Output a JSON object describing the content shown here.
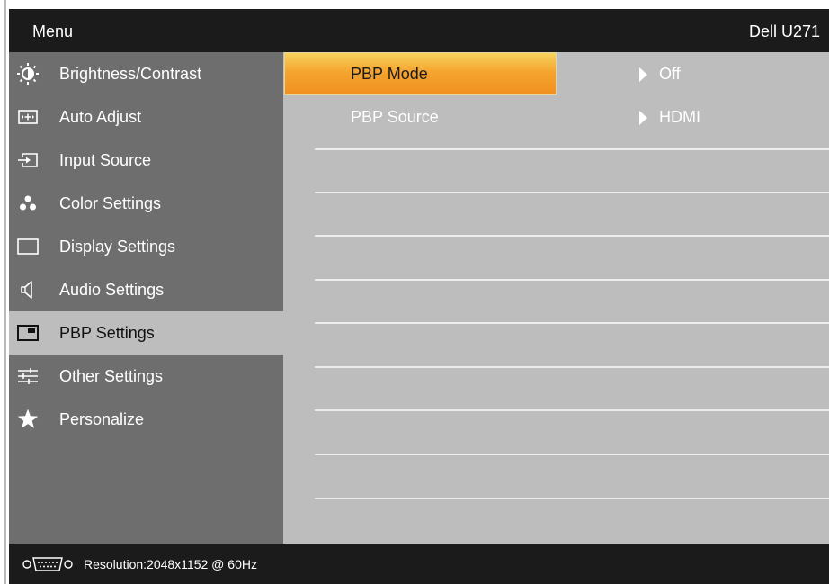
{
  "header": {
    "menu_title": "Menu",
    "model": "Dell U271"
  },
  "sidebar": {
    "items": [
      {
        "label": "Brightness/Contrast",
        "icon": "brightness-icon"
      },
      {
        "label": "Auto Adjust",
        "icon": "auto-adjust-icon"
      },
      {
        "label": "Input Source",
        "icon": "input-source-icon"
      },
      {
        "label": "Color Settings",
        "icon": "color-settings-icon"
      },
      {
        "label": "Display Settings",
        "icon": "display-settings-icon"
      },
      {
        "label": "Audio Settings",
        "icon": "speaker-icon"
      },
      {
        "label": "PBP Settings",
        "icon": "pbp-icon",
        "active": true
      },
      {
        "label": "Other Settings",
        "icon": "sliders-icon"
      },
      {
        "label": "Personalize",
        "icon": "star-icon"
      }
    ]
  },
  "options": [
    {
      "label": "PBP Mode",
      "value": "Off",
      "selected": true
    },
    {
      "label": "PBP Source",
      "value": "HDMI"
    }
  ],
  "status": {
    "resolution": "Resolution:2048x1152 @ 60Hz",
    "icon": "vga-port-icon"
  },
  "colors": {
    "titlebar": "#1b1b1b",
    "sidebar": "#6e6e6e",
    "content": "#bdbdbd",
    "highlight": "#f4a52f"
  }
}
